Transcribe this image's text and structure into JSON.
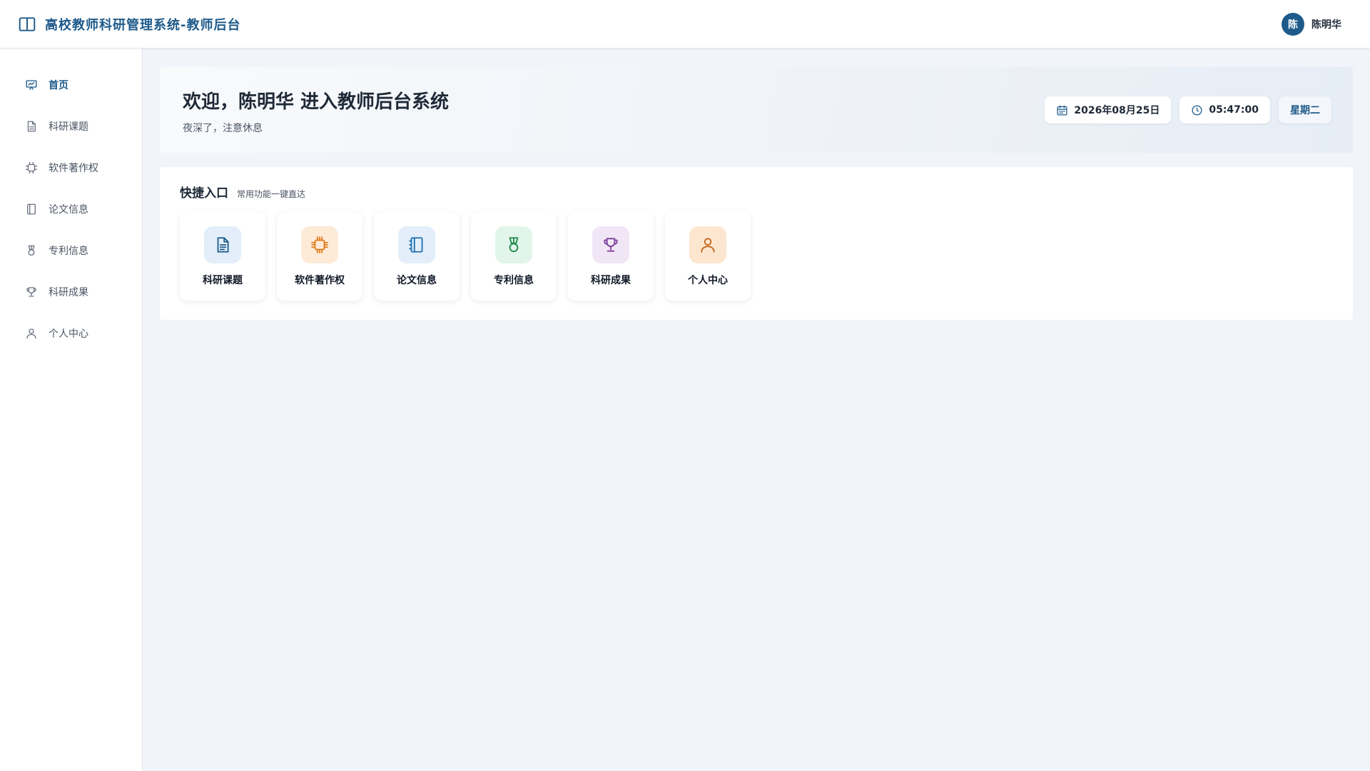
{
  "header": {
    "title": "高校教师科研管理系统-教师后台",
    "logo_icon": "book-open-icon",
    "user": {
      "avatar_text": "陈",
      "name": "陈明华"
    }
  },
  "sidebar": {
    "items": [
      {
        "label": "首页",
        "icon": "dashboard-chart-icon",
        "active": true
      },
      {
        "label": "科研课题",
        "icon": "document-icon",
        "active": false
      },
      {
        "label": "软件著作权",
        "icon": "chip-icon",
        "active": false
      },
      {
        "label": "论文信息",
        "icon": "notebook-icon",
        "active": false
      },
      {
        "label": "专利信息",
        "icon": "medal-icon",
        "active": false
      },
      {
        "label": "科研成果",
        "icon": "trophy-icon",
        "active": false
      },
      {
        "label": "个人中心",
        "icon": "user-icon",
        "active": false
      }
    ]
  },
  "welcome": {
    "title": "欢迎，陈明华 进入教师后台系统",
    "subtitle": "夜深了，注意休息",
    "date": "2026年08月25日",
    "time": "05:47:00",
    "weekday": "星期二"
  },
  "quick": {
    "title": "快捷入口",
    "subtitle": "常用功能一键直达",
    "cards": [
      {
        "label": "科研课题",
        "icon": "document-icon",
        "bg": "#e3eefa",
        "color": "#1e5a8a"
      },
      {
        "label": "软件著作权",
        "icon": "chip-icon",
        "bg": "#fdebd8",
        "color": "#e07b1a"
      },
      {
        "label": "论文信息",
        "icon": "notebook-icon",
        "bg": "#e3eefa",
        "color": "#1e6fb0"
      },
      {
        "label": "专利信息",
        "icon": "medal-icon",
        "bg": "#e2f5ea",
        "color": "#1f8a4c"
      },
      {
        "label": "科研成果",
        "icon": "trophy-icon",
        "bg": "#f1e6f5",
        "color": "#7b3f9a"
      },
      {
        "label": "个人中心",
        "icon": "user-icon",
        "bg": "#fde6cf",
        "color": "#c2641a"
      }
    ]
  },
  "colors": {
    "primary": "#1e5a8a",
    "background": "#f1f5f9"
  }
}
